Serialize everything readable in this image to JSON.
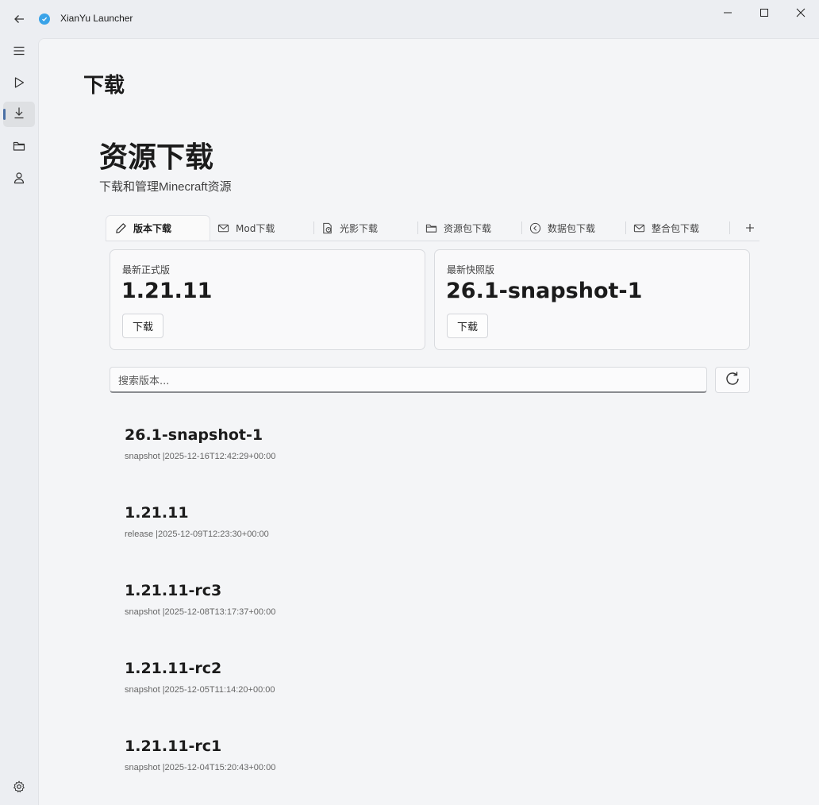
{
  "window": {
    "title": "XianYu Launcher",
    "controls": [
      "minimize-icon",
      "maximize-icon",
      "close-icon"
    ]
  },
  "nav": {
    "items": [
      {
        "name": "menu-icon"
      },
      {
        "name": "play-icon"
      },
      {
        "name": "download-icon",
        "active": true
      },
      {
        "name": "folder-icon"
      },
      {
        "name": "user-icon"
      }
    ],
    "footer": "settings-gear-icon"
  },
  "page": {
    "title": "下载",
    "section_title": "资源下载",
    "section_subtitle": "下载和管理Minecraft资源"
  },
  "tabs": [
    {
      "label": "版本下载",
      "icon": "pencil-icon",
      "active": true
    },
    {
      "label": "Mod下载",
      "icon": "mail-icon"
    },
    {
      "label": "光影下载",
      "icon": "shader-icon"
    },
    {
      "label": "资源包下载",
      "icon": "folder-icon"
    },
    {
      "label": "数据包下载",
      "icon": "back-circle-icon"
    },
    {
      "label": "整合包下载",
      "icon": "mail-icon"
    }
  ],
  "cards": {
    "release": {
      "label": "最新正式版",
      "version": "1.21.11",
      "button": "下载"
    },
    "snapshot": {
      "label": "最新快照版",
      "version": "26.1-snapshot-1",
      "button": "下载"
    }
  },
  "search": {
    "placeholder": "搜索版本..."
  },
  "versions": [
    {
      "name": "26.1-snapshot-1",
      "meta": "snapshot |2025-12-16T12:42:29+00:00"
    },
    {
      "name": "1.21.11",
      "meta": "release |2025-12-09T12:23:30+00:00"
    },
    {
      "name": "1.21.11-rc3",
      "meta": "snapshot |2025-12-08T13:17:37+00:00"
    },
    {
      "name": "1.21.11-rc2",
      "meta": "snapshot |2025-12-05T11:14:20+00:00"
    },
    {
      "name": "1.21.11-rc1",
      "meta": "snapshot |2025-12-04T15:20:43+00:00"
    }
  ],
  "colors": {
    "accent": "#4a6fa5",
    "logo": "#3aa3e8"
  }
}
